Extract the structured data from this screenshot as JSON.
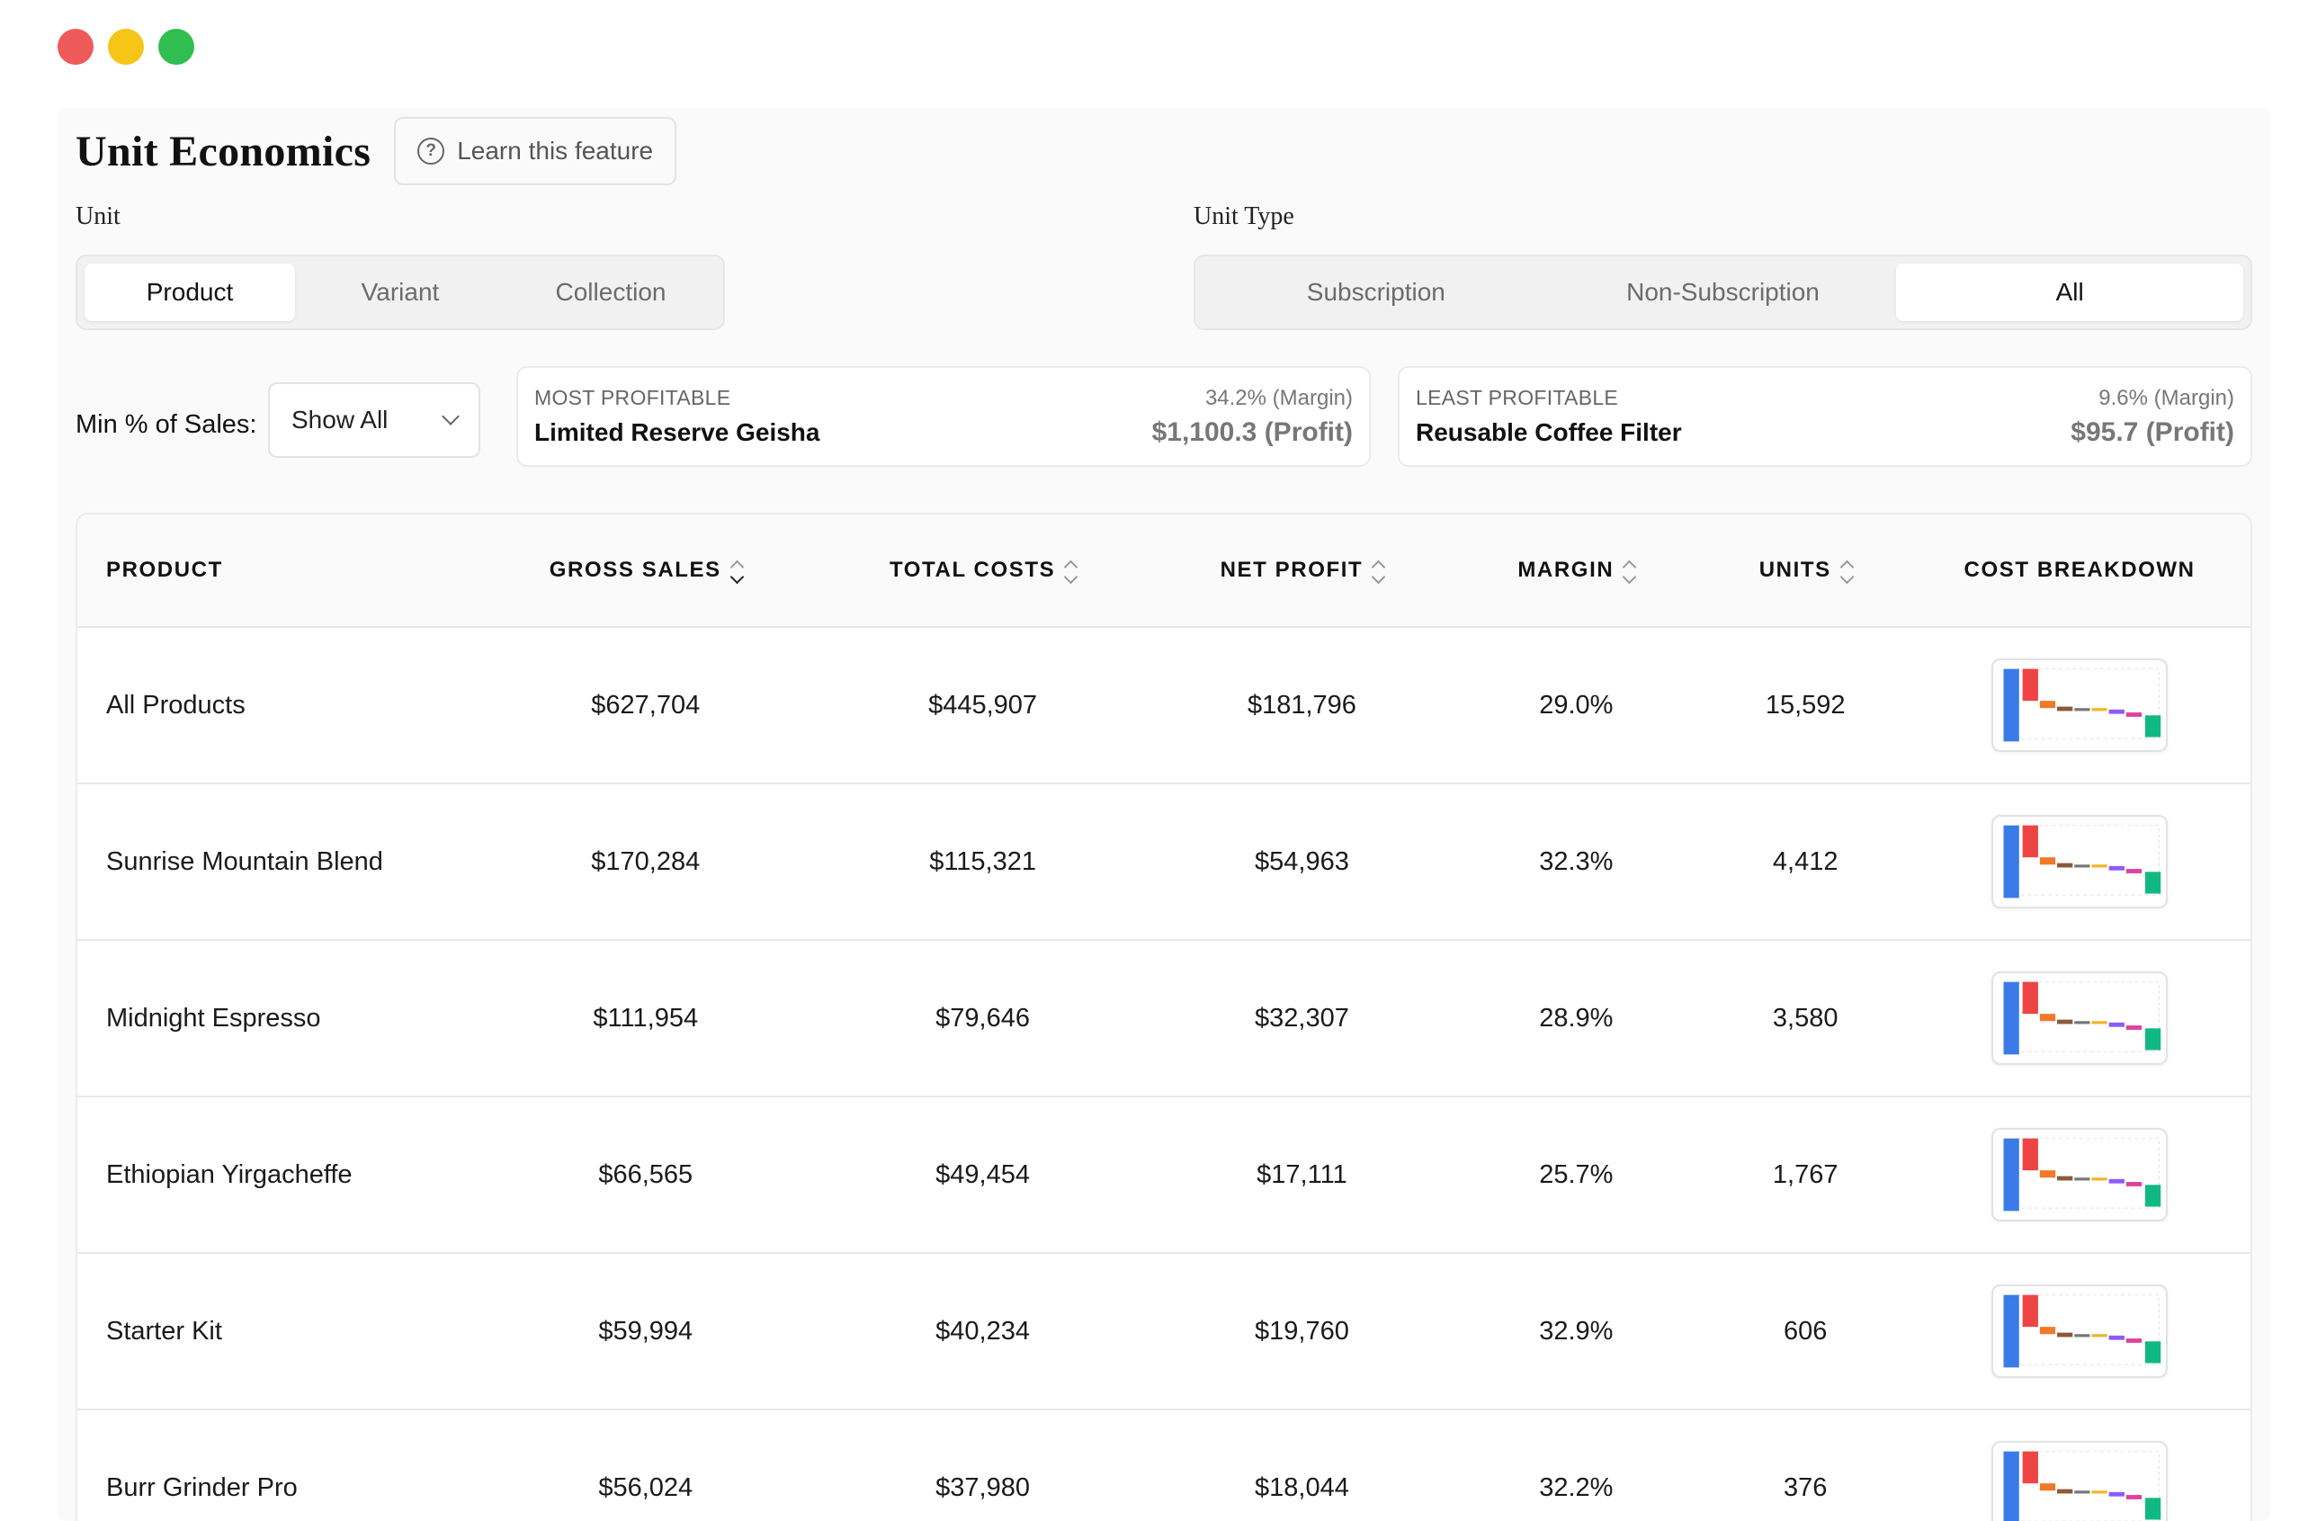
{
  "window": {
    "controls": {
      "close_color": "#ee5a5a",
      "minimize_color": "#f5c518",
      "maximize_color": "#2fbe4f"
    }
  },
  "header": {
    "title": "Unit Economics",
    "learn_button": {
      "label": "Learn this feature",
      "icon": "question-circle-icon"
    }
  },
  "unit": {
    "label": "Unit",
    "options": [
      "Product",
      "Variant",
      "Collection"
    ],
    "selected": "Product"
  },
  "unit_type": {
    "label": "Unit Type",
    "options": [
      "Subscription",
      "Non-Subscription",
      "All"
    ],
    "selected": "All"
  },
  "filter": {
    "label": "Min % of Sales:",
    "value": "Show All",
    "icon": "chevron-down-icon"
  },
  "most_profitable": {
    "kicker": "MOST PROFITABLE",
    "product": "Limited Reserve Geisha",
    "margin": "34.2% (Margin)",
    "profit": "$1,100.3 (Profit)"
  },
  "least_profitable": {
    "kicker": "LEAST PROFITABLE",
    "product": "Reusable Coffee Filter",
    "margin": "9.6% (Margin)",
    "profit": "$95.7 (Profit)"
  },
  "table": {
    "headers": {
      "product": "PRODUCT",
      "gross_sales": "GROSS SALES",
      "total_costs": "TOTAL COSTS",
      "net_profit": "NET PROFIT",
      "margin": "MARGIN",
      "units": "UNITS",
      "cost_breakdown": "COST BREAKDOWN"
    },
    "rows": [
      {
        "product": "All Products",
        "gross_sales": "$627,704",
        "total_costs": "$445,907",
        "net_profit": "$181,796",
        "margin": "29.0%",
        "units": "15,592"
      },
      {
        "product": "Sunrise Mountain Blend",
        "gross_sales": "$170,284",
        "total_costs": "$115,321",
        "net_profit": "$54,963",
        "margin": "32.3%",
        "units": "4,412"
      },
      {
        "product": "Midnight Espresso",
        "gross_sales": "$111,954",
        "total_costs": "$79,646",
        "net_profit": "$32,307",
        "margin": "28.9%",
        "units": "3,580"
      },
      {
        "product": "Ethiopian Yirgacheffe",
        "gross_sales": "$66,565",
        "total_costs": "$49,454",
        "net_profit": "$17,111",
        "margin": "25.7%",
        "units": "1,767"
      },
      {
        "product": "Starter Kit",
        "gross_sales": "$59,994",
        "total_costs": "$40,234",
        "net_profit": "$19,760",
        "margin": "32.9%",
        "units": "606"
      },
      {
        "product": "Burr Grinder Pro",
        "gross_sales": "$56,024",
        "total_costs": "$37,980",
        "net_profit": "$18,044",
        "margin": "32.2%",
        "units": "376"
      }
    ]
  },
  "breakdown_colors": [
    "#3b7be8",
    "#ee4444",
    "#f07a2a",
    "#8a5a3a",
    "#777777",
    "#f0b429",
    "#8b5cf6",
    "#e040a0",
    "#10b981"
  ]
}
